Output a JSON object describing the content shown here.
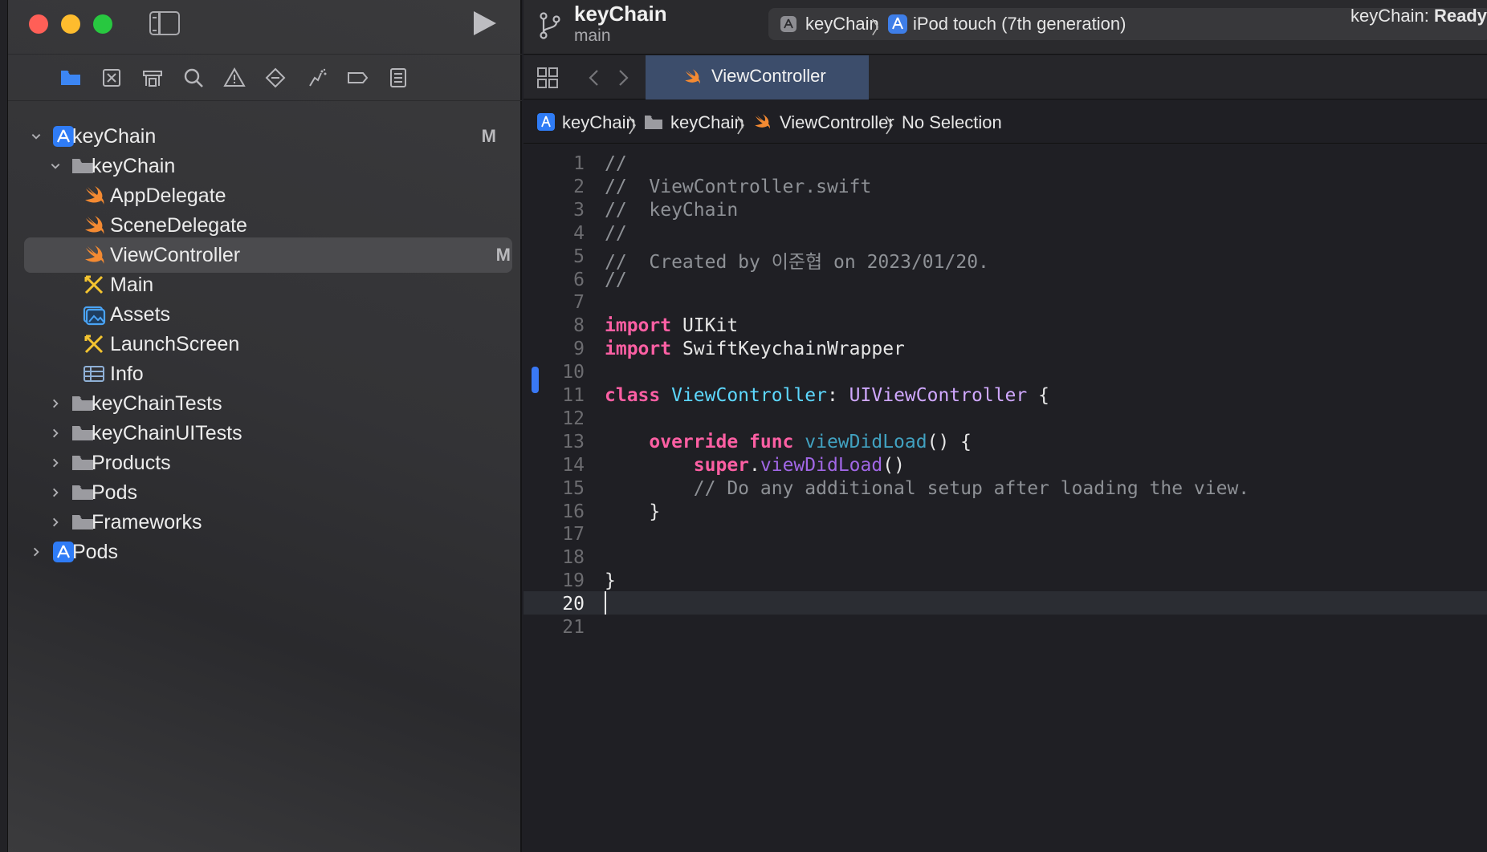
{
  "window": {
    "project_title": "keyChain",
    "branch": "main",
    "scheme": "keyChain",
    "device": "iPod touch (7th generation)",
    "status_prefix": "keyChain: ",
    "status_value": "Ready"
  },
  "navigator": {
    "toolbar_icons": [
      "folder-icon",
      "source-control-icon",
      "symbol-icon",
      "search-icon",
      "warning-icon",
      "test-icon",
      "debug-icon",
      "breakpoint-icon",
      "report-icon"
    ],
    "items": [
      {
        "label": "keyChain",
        "badge": "M",
        "icon": "xcode-project-icon",
        "expanded": true
      },
      {
        "label": "keyChain",
        "icon": "folder-icon",
        "expanded": true
      },
      {
        "label": "AppDelegate",
        "icon": "swift-icon"
      },
      {
        "label": "SceneDelegate",
        "icon": "swift-icon"
      },
      {
        "label": "ViewController",
        "badge": "M",
        "icon": "swift-icon",
        "selected": true
      },
      {
        "label": "Main",
        "icon": "storyboard-icon"
      },
      {
        "label": "Assets",
        "icon": "assets-icon"
      },
      {
        "label": "LaunchScreen",
        "icon": "storyboard-icon"
      },
      {
        "label": "Info",
        "icon": "plist-icon"
      },
      {
        "label": "keyChainTests",
        "icon": "folder-icon",
        "expanded": false
      },
      {
        "label": "keyChainUITests",
        "icon": "folder-icon",
        "expanded": false
      },
      {
        "label": "Products",
        "icon": "folder-icon",
        "expanded": false
      },
      {
        "label": "Pods",
        "icon": "folder-icon",
        "expanded": false
      },
      {
        "label": "Frameworks",
        "icon": "folder-icon",
        "expanded": false
      },
      {
        "label": "Pods",
        "icon": "xcode-project-icon",
        "expanded": false
      }
    ]
  },
  "editor": {
    "tab_label": "ViewController",
    "breadcrumbs": [
      "keyChain",
      "keyChain",
      "ViewController",
      "No Selection"
    ],
    "current_line": "20",
    "lines": [
      {
        "n": "1",
        "text": "//"
      },
      {
        "n": "2",
        "text": "//  ViewController.swift"
      },
      {
        "n": "3",
        "text": "//  keyChain"
      },
      {
        "n": "4",
        "text": "//"
      },
      {
        "n": "5",
        "text": "//  Created by 이준협 on 2023/01/20."
      },
      {
        "n": "6",
        "text": "//"
      },
      {
        "n": "7",
        "text": ""
      },
      {
        "n": "8",
        "kw": "import",
        "rest": " UIKit"
      },
      {
        "n": "9",
        "kw": "import",
        "rest": " SwiftKeychainWrapper"
      },
      {
        "n": "10",
        "text": ""
      },
      {
        "n": "11",
        "kw": "class",
        "name": " ViewController",
        "colon": ":",
        "super": " UIViewController",
        "tail": " {"
      },
      {
        "n": "12",
        "text": ""
      },
      {
        "n": "13",
        "indent": "    ",
        "kw": "override",
        "kw2": " func",
        "fn": " viewDidLoad",
        "tail": "() {"
      },
      {
        "n": "14",
        "indent": "        ",
        "kw": "super",
        "dot": ".",
        "method": "viewDidLoad",
        "tail": "()"
      },
      {
        "n": "15",
        "text": "        // Do any additional setup after loading the view."
      },
      {
        "n": "16",
        "text": "    }"
      },
      {
        "n": "17",
        "text": ""
      },
      {
        "n": "18",
        "text": ""
      },
      {
        "n": "19",
        "text": "}"
      },
      {
        "n": "20",
        "text": ""
      },
      {
        "n": "21",
        "text": ""
      }
    ]
  },
  "colors": {
    "keyword": "#fc5fa3",
    "type_decl": "#5dd8ff",
    "type_ref": "#d0a8ff",
    "comment": "#8e9196",
    "accent_tab": "#3c4d6b",
    "change_bar": "#3978f5"
  }
}
